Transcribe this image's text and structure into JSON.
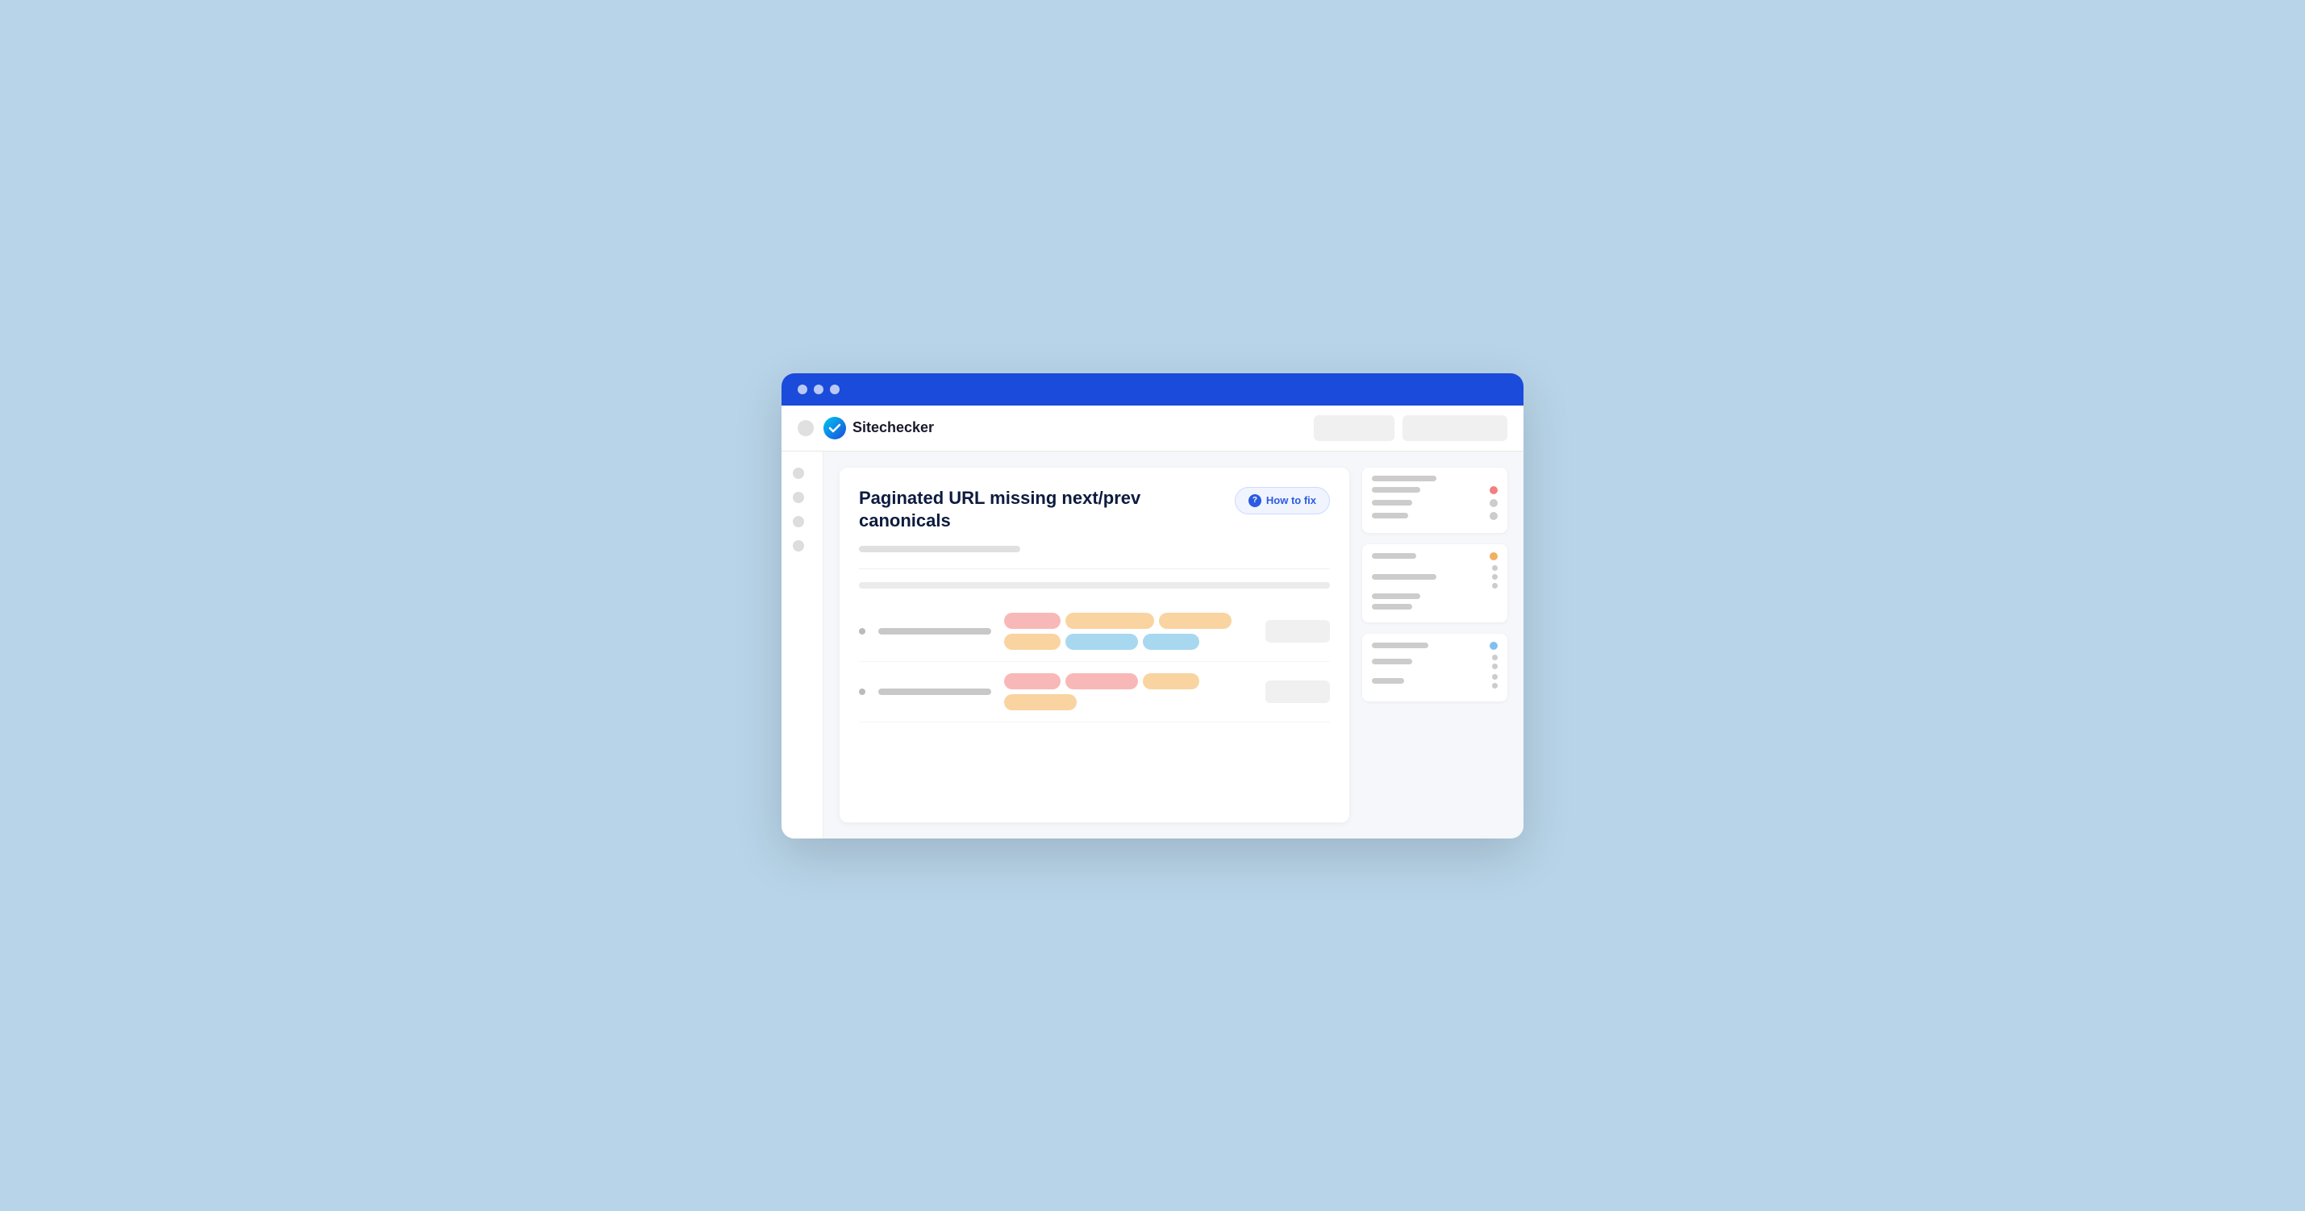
{
  "browser": {
    "titlebar": {
      "dots": [
        "dot1",
        "dot2",
        "dot3"
      ]
    },
    "toolbar": {
      "logo_text": "Sitechecker",
      "btn1_label": "",
      "btn2_label": ""
    }
  },
  "content": {
    "issue": {
      "title": "Paginated URL missing next/prev canonicals",
      "subtitle_bar": true,
      "how_to_fix_label": "How to fix"
    },
    "rows": [
      {
        "tags": [
          {
            "color": "pink",
            "size": "sm"
          },
          {
            "color": "peach",
            "size": "lg"
          },
          {
            "color": "peach",
            "size": "md"
          },
          {
            "color": "peach",
            "size": "sm"
          },
          {
            "color": "blue",
            "size": "md"
          },
          {
            "color": "blue",
            "size": "sm"
          }
        ]
      },
      {
        "tags": [
          {
            "color": "pink",
            "size": "sm"
          },
          {
            "color": "pink",
            "size": "md"
          },
          {
            "color": "peach",
            "size": "sm"
          },
          {
            "color": "peach",
            "size": "md"
          }
        ]
      }
    ]
  },
  "right_panel": {
    "sections": [
      {
        "bars": [
          {
            "width": 80,
            "dot": "none"
          },
          {
            "width": 60,
            "dot": "red"
          },
          {
            "width": 50,
            "dot": "none"
          },
          {
            "width": 40,
            "dot": "none"
          }
        ]
      },
      {
        "bars": [
          {
            "width": 55,
            "dot": "orange"
          },
          {
            "width": 80,
            "dot": "none"
          },
          {
            "width": 60,
            "dot": "none"
          },
          {
            "width": 45,
            "dot": "none"
          }
        ]
      },
      {
        "bars": [
          {
            "width": 70,
            "dot": "blue"
          },
          {
            "width": 50,
            "dot": "none"
          },
          {
            "width": 40,
            "dot": "none"
          }
        ]
      }
    ]
  },
  "icons": {
    "check_mark": "✓",
    "question_mark": "?"
  }
}
